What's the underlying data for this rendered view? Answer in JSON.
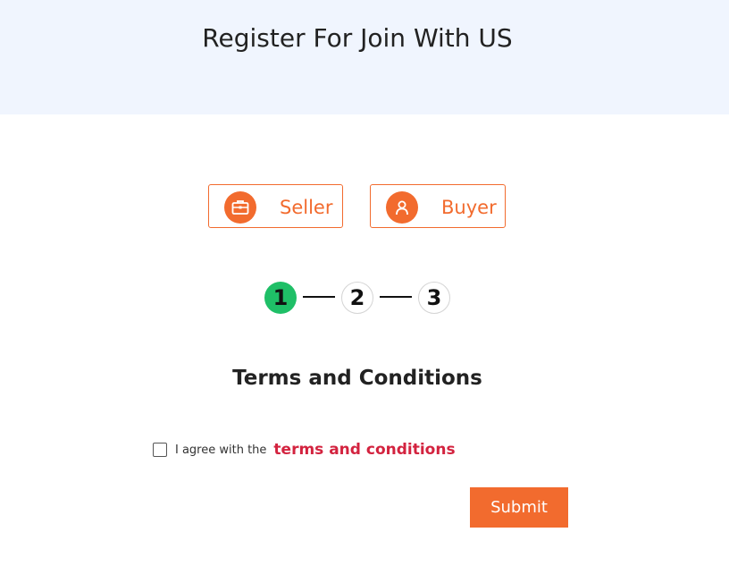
{
  "header": {
    "title": "Register For Join With US"
  },
  "roles": {
    "seller": {
      "label": "Seller",
      "icon": "briefcase-icon"
    },
    "buyer": {
      "label": "Buyer",
      "icon": "user-icon"
    }
  },
  "steps": {
    "items": [
      "1",
      "2",
      "3"
    ],
    "active": 1,
    "active_color": "#1fbf67"
  },
  "section": {
    "title": "Terms and Conditions"
  },
  "agreement": {
    "checked": false,
    "text": "I agree with the",
    "link_text": "terms and conditions"
  },
  "submit": {
    "label": "Submit"
  },
  "colors": {
    "accent": "#f26b2e",
    "link": "#d3233f",
    "header_bg": "#f0f5fe"
  }
}
